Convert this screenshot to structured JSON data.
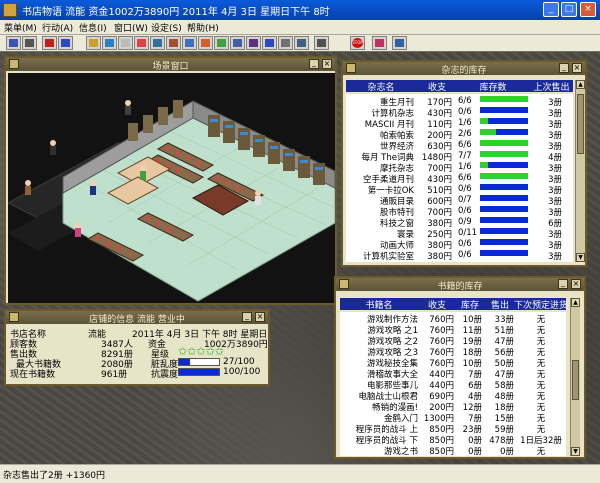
{
  "app": {
    "title": "书店物语 流能 资金1002万3890円  2011年 4月  3日 星期日下午 8时",
    "win_min": "_",
    "win_max": "□",
    "win_close": "×"
  },
  "menu": [
    {
      "label": "菜单(M)"
    },
    {
      "label": "行动(A)"
    },
    {
      "label": "信息(I)"
    },
    {
      "label": "窗口(W)"
    },
    {
      "label": "设定(S)"
    },
    {
      "label": "帮助(H)"
    }
  ],
  "toolbar_icons": [
    {
      "name": "save-icon",
      "color": "#3a55b0"
    },
    {
      "name": "print-icon",
      "color": "#555555"
    },
    {
      "name": "transfer-red-icon",
      "color": "#c0201a"
    },
    {
      "name": "transfer-blue-icon",
      "color": "#2a4bc0"
    },
    {
      "name": "edit-icon",
      "color": "#c8a030"
    },
    {
      "name": "move-icon",
      "color": "#2a80c0"
    },
    {
      "name": "document-icon",
      "color": "#bbbbbb"
    },
    {
      "name": "calendar-icon",
      "color": "#e04040"
    },
    {
      "name": "order-icon",
      "color": "#3070a0"
    },
    {
      "name": "shop-icon",
      "color": "#a05030"
    },
    {
      "name": "house-icon",
      "color": "#4070c0"
    },
    {
      "name": "people-icon",
      "color": "#d06030"
    },
    {
      "name": "chart-icon",
      "color": "#40a040"
    },
    {
      "name": "screen-icon",
      "color": "#4060a0"
    },
    {
      "name": "book-icon",
      "color": "#603080"
    },
    {
      "name": "list-icon",
      "color": "#2a4bc0"
    },
    {
      "name": "report-icon",
      "color": "#707070"
    },
    {
      "name": "window-icon",
      "color": "#406080"
    },
    {
      "name": "grid-icon",
      "color": "#505050"
    },
    {
      "name": "stop-icon",
      "color": "#d01010"
    },
    {
      "name": "face-icon",
      "color": "#c03060"
    },
    {
      "name": "help-icon",
      "color": "#3060a0"
    }
  ],
  "stop_label": "STOP",
  "scene_window": {
    "title": "场景窗口"
  },
  "magazine_window": {
    "title": "杂志的库存",
    "headers": [
      "杂志名",
      "收支",
      "库存数",
      "上次售出"
    ],
    "rows": [
      {
        "name": "重生月刊",
        "price": "170円",
        "stock": "6/6",
        "fill": 1.0,
        "sold": "3册"
      },
      {
        "name": "计算机杂志",
        "price": "430円",
        "stock": "0/6",
        "fill": 0.0,
        "sold": "3册"
      },
      {
        "name": "MASCII 月刊",
        "price": "110円",
        "stock": "1/6",
        "fill": 0.17,
        "sold": "3册"
      },
      {
        "name": "帕索帕索",
        "price": "200円",
        "stock": "2/6",
        "fill": 0.33,
        "sold": "3册"
      },
      {
        "name": "世界经济",
        "price": "630円",
        "stock": "6/6",
        "fill": 1.0,
        "sold": "3册"
      },
      {
        "name": "每月 The词典",
        "price": "1480円",
        "stock": "7/7",
        "fill": 1.0,
        "sold": "4册"
      },
      {
        "name": "摩托杂志",
        "price": "700円",
        "stock": "1/6",
        "fill": 0.17,
        "sold": "3册"
      },
      {
        "name": "空手柔道月刊",
        "price": "430円",
        "stock": "6/6",
        "fill": 1.0,
        "sold": "3册"
      },
      {
        "name": "第一卡拉OK",
        "price": "510円",
        "stock": "0/6",
        "fill": 0.0,
        "sold": "3册"
      },
      {
        "name": "通販目录",
        "price": "600円",
        "stock": "0/7",
        "fill": 0.0,
        "sold": "3册"
      },
      {
        "name": "股市特刊",
        "price": "700円",
        "stock": "0/6",
        "fill": 0.0,
        "sold": "3册"
      },
      {
        "name": "科技之窗",
        "price": "380円",
        "stock": "0/9",
        "fill": 0.0,
        "sold": "6册"
      },
      {
        "name": "寰录",
        "price": "250円",
        "stock": "0/11",
        "fill": 0.0,
        "sold": "3册"
      },
      {
        "name": "动画大师",
        "price": "380円",
        "stock": "0/6",
        "fill": 0.0,
        "sold": "3册"
      },
      {
        "name": "计算机实验室",
        "price": "380円",
        "stock": "0/6",
        "fill": 0.0,
        "sold": "3册"
      }
    ]
  },
  "book_window": {
    "title": "书籍的库存",
    "headers": [
      "书籍名",
      "收支",
      "库存",
      "售出",
      "下次预定进货"
    ],
    "rows": [
      {
        "name": "游戏制作方法",
        "price": "760円",
        "stock": "10册",
        "sold": "33册",
        "next": "无"
      },
      {
        "name": "游戏攻略 之1",
        "price": "760円",
        "stock": "11册",
        "sold": "51册",
        "next": "无"
      },
      {
        "name": "游戏攻略 之2",
        "price": "760円",
        "stock": "19册",
        "sold": "47册",
        "next": "无"
      },
      {
        "name": "游戏攻略 之3",
        "price": "760円",
        "stock": "18册",
        "sold": "56册",
        "next": "无"
      },
      {
        "name": "游戏秘技全集",
        "price": "760円",
        "stock": "10册",
        "sold": "50册",
        "next": "无"
      },
      {
        "name": "滑稽故事大全",
        "price": "440円",
        "stock": "7册",
        "sold": "47册",
        "next": "无"
      },
      {
        "name": "电影那些事儿",
        "price": "440円",
        "stock": "6册",
        "sold": "58册",
        "next": "无"
      },
      {
        "name": "电脑战士山根君",
        "price": "690円",
        "stock": "4册",
        "sold": "48册",
        "next": "无"
      },
      {
        "name": "畅销的漫画!",
        "price": "200円",
        "stock": "12册",
        "sold": "18册",
        "next": "无"
      },
      {
        "name": "金鹤入门",
        "price": "1300円",
        "stock": "7册",
        "sold": "15册",
        "next": "无"
      },
      {
        "name": "程序员的战斗 上",
        "price": "850円",
        "stock": "23册",
        "sold": "59册",
        "next": "无"
      },
      {
        "name": "程序员的战斗 下",
        "price": "850円",
        "stock": "0册",
        "sold": "478册",
        "next": "1日后32册"
      },
      {
        "name": "游戏之书",
        "price": "850円",
        "stock": "0册",
        "sold": "0册",
        "next": "无"
      }
    ]
  },
  "info_window": {
    "title": "店铺的信息 流能 营业中",
    "store_name_label": "书店名称",
    "store_name": "流能",
    "date": "2011年  4月   3日  下午  8时 星期日",
    "customers_label": "顾客数",
    "customers": "3487人",
    "funds_label": "资金",
    "funds": "1002万3890円",
    "sales_label": "售出数",
    "sales": "8291册",
    "max_books_label": "最大书籍数",
    "max_books": "2080册",
    "current_books_label": "现在书籍数",
    "current_books": "961册",
    "stars_label": "星级",
    "stars": 5,
    "dirt_label": "脏乱度",
    "dirt_value": "27/100",
    "dirt_fill": 0.27,
    "resist_label": "抗震度",
    "resist_value": "100/100",
    "resist_fill": 1.0
  },
  "status": {
    "text": "杂志售出了2册  +1360円"
  }
}
